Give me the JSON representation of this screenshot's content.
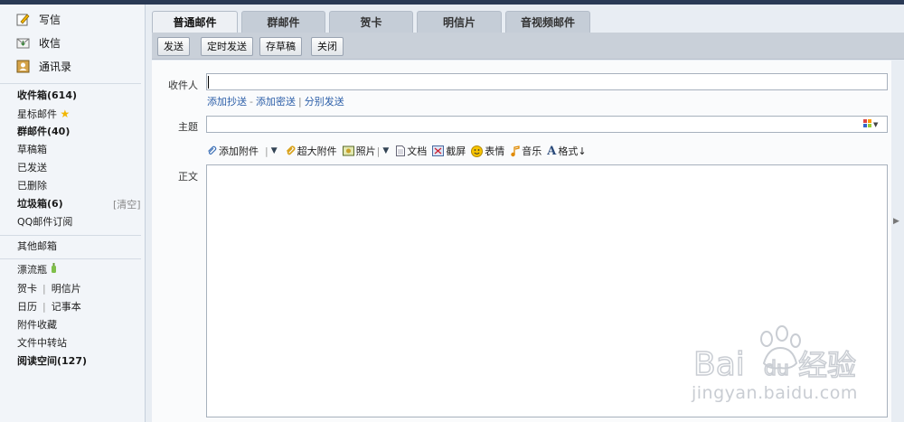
{
  "sidebar": {
    "quick": [
      {
        "label": "写信",
        "icon": "pencil-icon"
      },
      {
        "label": "收信",
        "icon": "inbox-icon"
      },
      {
        "label": "通讯录",
        "icon": "contacts-icon"
      }
    ],
    "folders": {
      "inbox": "收件箱(614)",
      "starred": "星标邮件",
      "group": "群邮件(40)",
      "drafts": "草稿箱",
      "sent": "已发送",
      "deleted": "已删除",
      "spam": "垃圾箱(6)",
      "spam_clear": "[清空]",
      "subscription": "QQ邮件订阅",
      "other": "其他邮箱",
      "bottle": "漂流瓶",
      "card": "贺卡",
      "postcard": "明信片",
      "calendar": "日历",
      "notes": "记事本",
      "attachments": "附件收藏",
      "transfer": "文件中转站",
      "reading": "阅读空间(127)"
    }
  },
  "tabs": [
    "普通邮件",
    "群邮件",
    "贺卡",
    "明信片",
    "音视频邮件"
  ],
  "toolbar": {
    "send": "发送",
    "scheduled": "定时发送",
    "save_draft": "存草稿",
    "close": "关闭"
  },
  "compose": {
    "to_label": "收件人",
    "to_value": "",
    "cc": "添加抄送",
    "bcc": "添加密送",
    "separate": "分别发送",
    "subject_label": "主题",
    "subject_value": "",
    "body_label": "正文",
    "body_value": ""
  },
  "attach_bar": {
    "attach": "添加附件",
    "large_attach": "超大附件",
    "photo": "照片",
    "document": "文档",
    "screenshot": "截屏",
    "emoji": "表情",
    "music": "音乐",
    "format": "格式↓"
  },
  "watermark": {
    "logo": "Baidu经验",
    "url": "jingyan.baidu.com"
  },
  "colors": {
    "link": "#2b5ea8",
    "toolbar_bg": "#c9d0d9",
    "tab_active": "#edf0f4",
    "topbar": "#2a3a55"
  }
}
